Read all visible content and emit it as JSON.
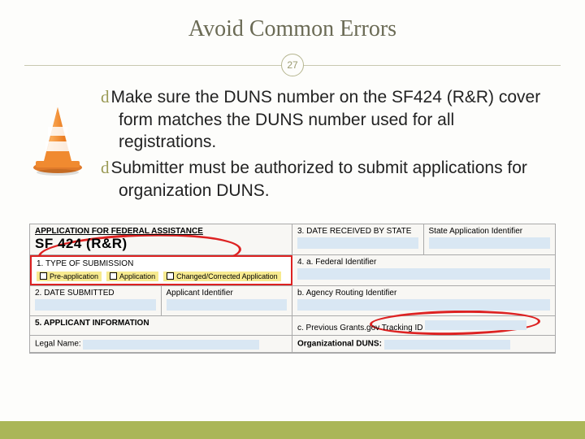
{
  "title": "Avoid Common Errors",
  "page_number": "27",
  "bullets": [
    "Make sure the DUNS number on the SF424 (R&R) cover form matches the DUNS number used for all registrations.",
    "Submitter must be authorized to submit applications for organization DUNS."
  ],
  "form": {
    "app_heading": "APPLICATION FOR FEDERAL ASSISTANCE",
    "sf_title": "SF 424 (R&R)",
    "type_sub_label": "1. TYPE OF SUBMISSION",
    "opts": [
      "Pre-application",
      "Application",
      "Changed/Corrected Application"
    ],
    "date_submitted": "2. DATE SUBMITTED",
    "applicant_identifier": "Applicant Identifier",
    "date_received_state": "3. DATE RECEIVED BY STATE",
    "state_app_id": "State Application Identifier",
    "federal_id": "4. a. Federal Identifier",
    "agency_routing": "b. Agency Routing Identifier",
    "prev_grants": "c. Previous Grants.gov Tracking ID",
    "applicant_info": "5. APPLICANT INFORMATION",
    "org_duns": "Organizational DUNS:",
    "legal_name": "Legal Name:"
  },
  "icons": {
    "bullet_glyph": "d"
  }
}
